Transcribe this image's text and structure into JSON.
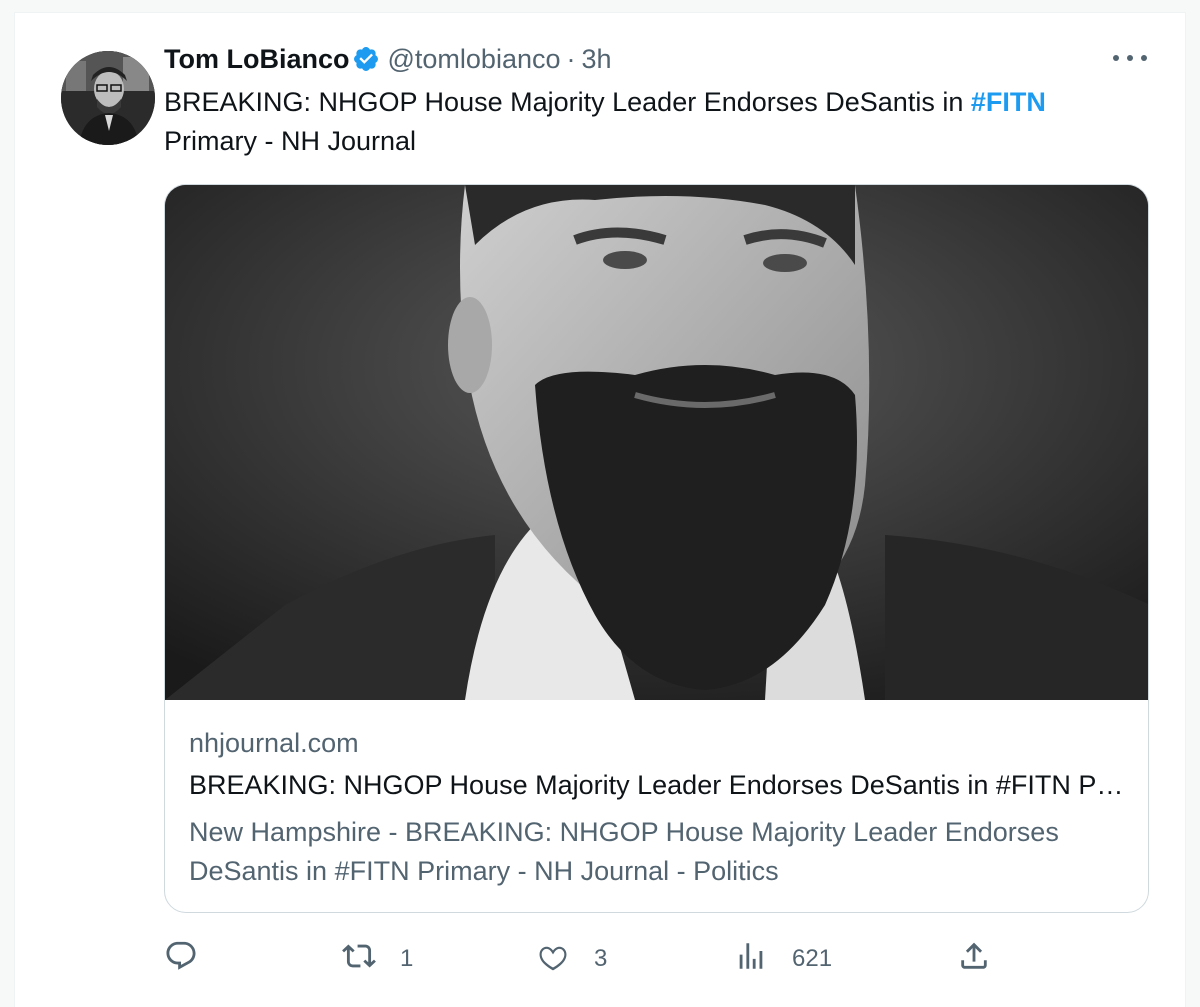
{
  "tweet": {
    "author_name": "Tom LoBianco",
    "handle": "@tomlobianco",
    "separator": "·",
    "time": "3h",
    "text_before": "BREAKING: NHGOP House Majority Leader Endorses DeSantis in ",
    "hashtag": "#FITN",
    "text_after": "Primary - NH Journal",
    "verified_color": "#1d9bf0"
  },
  "card": {
    "domain": "nhjournal.com",
    "title": "BREAKING: NHGOP House Majority Leader Endorses DeSantis in #FITN Primary - NH Journal",
    "description": "New Hampshire - BREAKING: NHGOP House Majority Leader Endorses DeSantis in #FITN Primary - NH Journal - Politics"
  },
  "actions": {
    "reply_icon": "reply-icon",
    "retweet_count": "1",
    "like_count": "3",
    "views_count": "621",
    "share_icon": "share-icon"
  },
  "colors": {
    "accent": "#1d9bf0",
    "secondary_text": "#536471",
    "border": "#cfd9de"
  }
}
